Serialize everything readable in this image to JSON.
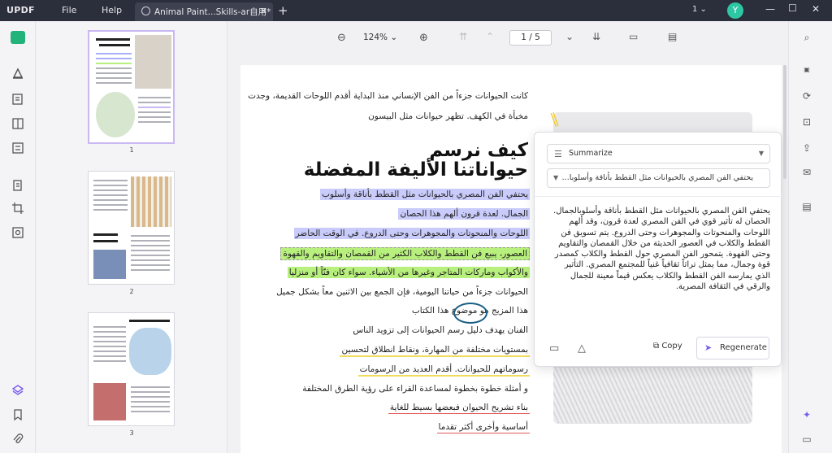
{
  "app": {
    "logo": "UPDF",
    "menu": [
      "File",
      "Help"
    ],
    "tab_title": "Animal Paint...Skills-ar自用*",
    "page_select": "1",
    "avatar_letter": "Y"
  },
  "toolbar": {
    "zoom": "124%",
    "page_current": "1",
    "page_sep": "/",
    "page_total": "5"
  },
  "thumbnails": [
    {
      "number": "1",
      "selected": true
    },
    {
      "number": "2",
      "selected": false
    },
    {
      "number": "3",
      "selected": false
    }
  ],
  "document": {
    "intro_lines": [
      "كانت الحيوانات جزءاً من الفن الإنساني منذ البداية أقدم اللوحات القديمة، وجدت",
      "مخبأة في الكهف. تظهر حيوانات مثل البيسون"
    ],
    "title_line1": "كيف نرسم",
    "title_line2": "حيواناتنا الأليفة المفضلة",
    "body_lines": [
      {
        "text": "يحتفي الفن المصري بالحيوانات مثل القطط بأناقة وأسلوب",
        "style": "hl-blue"
      },
      {
        "text": "الجمال. لعدة قرون ألهم هذا الحصان",
        "style": "hl-blue"
      },
      {
        "text": "اللوحات والمنحوتات والمجوهرات وحتى الدروع. في الوقت الحاضر",
        "style": "hl-blue"
      },
      {
        "text": "العصور، يبيع فن القطط والكلاب الكثير من القمصان والتقاويم والقهوة",
        "style": "hl-green hl-dash"
      },
      {
        "text": "والأكواب وماركات المتاجر وغيرها من الأشياء. سواء كان فنّاً أو منزليا",
        "style": "hl-green"
      },
      {
        "text": "الحيوانات جزءاً من حياتنا اليومية، فإن الجمع بين الاثنين معاً بشكل جميل",
        "style": ""
      },
      {
        "text": "هذا المزيج هو موضوع هذا الكتاب",
        "style": ""
      },
      {
        "text": "الفنان يهدف دليل رسم الحيوانات إلى تزويد الناس",
        "style": ""
      },
      {
        "text": "بمستويات مختلفة من المهارة، ونقاط انطلاق لتحسين",
        "style": "ul-yellow"
      },
      {
        "text": "رسوماتهم للحيوانات. أقدم العديد من الرسومات",
        "style": "ul-yellow"
      },
      {
        "text": "و أمثلة خطوة بخطوة لمساعدة القراء على رؤية الطرق المختلفة",
        "style": ""
      },
      {
        "text": "بناء تشريح الحيوان فبعضها بسيط للغاية",
        "style": "ul-red"
      },
      {
        "text": "أساسية وأخرى أكثر تقدما",
        "style": "ul-red"
      }
    ]
  },
  "ai_panel": {
    "mode": "Summarize",
    "selected_text": "يحتفي الفن المصري بالحيوانات مثل القطط بأناقة وأسلوبا...",
    "summary": "يحتفي الفن المصري بالحيوانات مثل القطط بأناقة وأسلوبالجمال. الحصان له تأثير قوي في الفن المصري لعدة قرون، وقد ألهم اللوحات والمنحوتات والمجوهرات وحتى الدروع. يتم تسويق فن القطط والكلاب في العصور الحديثة من خلال القمصان والتقاويم وحتى القهوة. يتمحور الفن المصري حول القطط والكلاب كمصدر قوة وجمال، مما يمثل تراثاً ثقافياً غنياً للمجتمع المصري. التأثير الذي يمارسه الفن القطط والكلاب يعكس قيماً معينة للجمال والرقي في الثقافة المصرية.",
    "copy_label": "Copy",
    "regenerate_label": "Regenerate"
  },
  "colors": {
    "titlebar": "#2b2e3b",
    "highlight_blue": "#c9cbfa",
    "highlight_green": "#b8f07d",
    "accent_purple": "#7a5cf0",
    "circle_annotation": "#1b5f86"
  }
}
